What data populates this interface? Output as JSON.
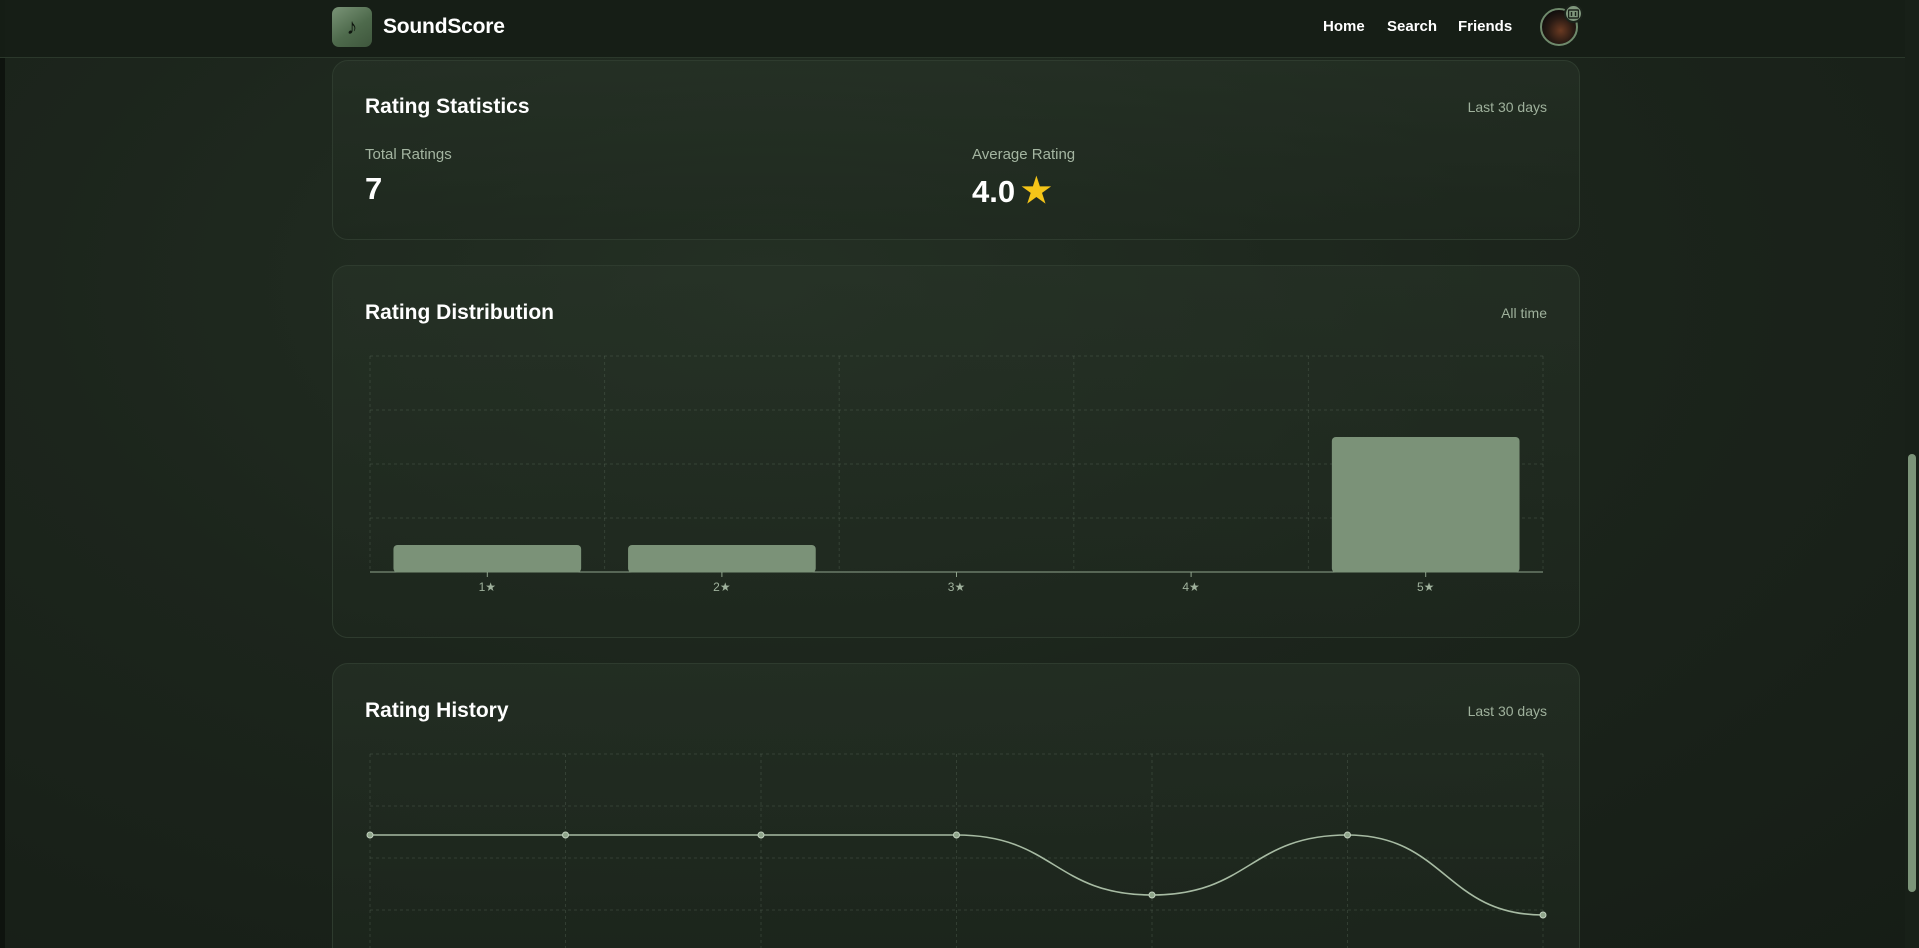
{
  "app": {
    "brand": "SoundScore",
    "logo_icon": "music-note-icon",
    "nav": [
      {
        "label": "Home"
      },
      {
        "label": "Search"
      },
      {
        "label": "Friends"
      }
    ]
  },
  "stats": {
    "title": "Rating Statistics",
    "range": "Last 30 days",
    "total_label": "Total Ratings",
    "total_value": "7",
    "average_label": "Average Rating",
    "average_value": "4.0",
    "average_icon": "star-icon"
  },
  "distribution": {
    "title": "Rating Distribution",
    "range": "All time"
  },
  "history": {
    "title": "Rating History",
    "range": "Last 30 days"
  },
  "colors": {
    "accent": "#7b9278",
    "star": "#f5c518",
    "background": "#1c251c"
  },
  "chart_data": [
    {
      "type": "bar",
      "categories": [
        "1★",
        "2★",
        "3★",
        "4★",
        "5★"
      ],
      "values": [
        1,
        1,
        0,
        0,
        5
      ],
      "ylim": [
        0,
        8
      ],
      "grid": true
    },
    {
      "type": "line",
      "values": [
        4,
        4,
        4,
        4,
        1,
        4,
        0
      ],
      "grid": true,
      "smooth": true
    }
  ]
}
